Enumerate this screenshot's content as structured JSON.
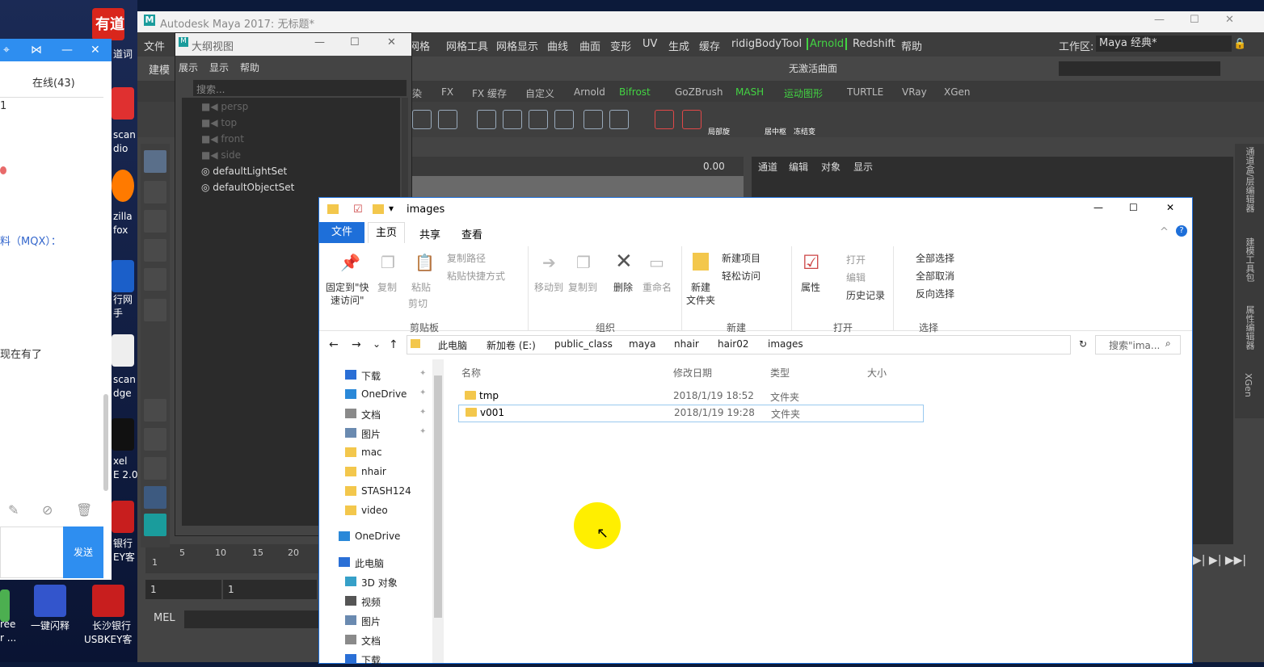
{
  "desktop": {
    "icons": [
      {
        "label": "有道",
        "color": "#d9261c"
      },
      {
        "label": "道词",
        "color": "#d9261c"
      },
      {
        "label": "scan",
        "color": "#e03030"
      },
      {
        "label": "dio",
        "color": "#e03030"
      },
      {
        "label": "zilla",
        "color": "#ff7a00"
      },
      {
        "label": "fox",
        "color": "#ff7a00"
      },
      {
        "label": "行网",
        "color": "#1b5fc9"
      },
      {
        "label": "手",
        "color": "#1b5fc9"
      },
      {
        "label": "scan",
        "color": "#eeeeee"
      },
      {
        "label": "dge",
        "color": "#eeeeee"
      },
      {
        "label": "xel",
        "color": "#111111"
      },
      {
        "label": "E 2.0",
        "color": "#111111"
      },
      {
        "label": "银行",
        "color": "#c81e1e"
      },
      {
        "label": "EY客",
        "color": "#c81e1e"
      },
      {
        "label": "一键闪释",
        "color": "#3355cc"
      },
      {
        "label": "长沙银行",
        "color": "#c81e1e"
      },
      {
        "label": "USBKEY客",
        "color": "#c81e1e"
      },
      {
        "label": "ree",
        "color": "#4caf50"
      },
      {
        "label": "r ...",
        "color": "#4caf50"
      }
    ]
  },
  "chat": {
    "status": "在线(43)",
    "lines": [
      "1",
      "料（MQX）：",
      "现在有了"
    ],
    "send_label": "发送"
  },
  "maya": {
    "title": "Autodesk Maya 2017: 无标题*",
    "menu": [
      "文件",
      "网格",
      "网格工具",
      "网格显示",
      "曲线",
      "曲面",
      "变形",
      "UV",
      "生成",
      "缓存",
      "ridigBodyTool",
      "Arnold",
      "Redshift",
      "帮助"
    ],
    "workspace_label": "工作区:",
    "workspace_value": "Maya 经典*",
    "left_mode": "建模",
    "no_live_surface": "无激活曲面",
    "shelf_tabs": [
      "染",
      "FX",
      "FX 缓存",
      "自定义",
      "Arnold",
      "Bifrost",
      "GoZBrush",
      "MASH",
      "运动图形",
      "TURTLE",
      "VRay",
      "XGen"
    ],
    "shelf_labels": [
      "局部旋",
      "居中枢",
      "冻结变"
    ],
    "viewport_value": "0.00",
    "channel_tabs": [
      "通道",
      "编辑",
      "对象",
      "显示"
    ],
    "side_tabs": [
      "通道盒/层编辑器",
      "建模工具包",
      "属性编辑器",
      "XGen"
    ],
    "timeline_ticks": [
      "1",
      "5",
      "10",
      "15",
      "20"
    ],
    "frame_fields": [
      "1",
      "1"
    ],
    "cmd_label": "MEL"
  },
  "outliner": {
    "title": "大纲视图",
    "menu": [
      "展示",
      "显示",
      "帮助"
    ],
    "search_placeholder": "搜索...",
    "items": [
      {
        "label": "persp",
        "dim": true
      },
      {
        "label": "top",
        "dim": true
      },
      {
        "label": "front",
        "dim": true
      },
      {
        "label": "side",
        "dim": true
      },
      {
        "label": "defaultLightSet",
        "dim": false
      },
      {
        "label": "defaultObjectSet",
        "dim": false
      }
    ]
  },
  "explorer": {
    "title": "images",
    "tabs": [
      "文件",
      "主页",
      "共享",
      "查看"
    ],
    "ribbon": {
      "pin": "固定到\"快",
      "pin2": "速访问\"",
      "copy": "复制",
      "paste": "粘贴",
      "copy_path": "复制路径",
      "paste_shortcut": "粘贴快捷方式",
      "cut": "剪切",
      "move_to": "移动到",
      "copy_to": "复制到",
      "delete": "删除",
      "rename": "重命名",
      "new_folder": "新建",
      "new_folder2": "文件夹",
      "new_item": "新建项目",
      "easy_access": "轻松访问",
      "properties": "属性",
      "open": "打开",
      "edit": "编辑",
      "history": "历史记录",
      "select_all": "全部选择",
      "select_none": "全部取消",
      "invert": "反向选择",
      "groups": [
        "剪贴板",
        "组织",
        "新建",
        "打开",
        "选择"
      ]
    },
    "breadcrumb": [
      "此电脑",
      "新加卷 (E:)",
      "public_class",
      "maya",
      "nhair",
      "hair02",
      "images"
    ],
    "search_placeholder": "搜索\"ima...",
    "nav": [
      {
        "label": "下载",
        "icon": "download-icon",
        "pin": true
      },
      {
        "label": "OneDrive",
        "icon": "cloud-icon",
        "pin": true
      },
      {
        "label": "文档",
        "icon": "document-icon",
        "pin": true
      },
      {
        "label": "图片",
        "icon": "picture-icon",
        "pin": true
      },
      {
        "label": "mac",
        "icon": "folder-icon",
        "pin": false
      },
      {
        "label": "nhair",
        "icon": "folder-icon",
        "pin": false
      },
      {
        "label": "STASH124",
        "icon": "folder-icon",
        "pin": false
      },
      {
        "label": "video",
        "icon": "folder-icon",
        "pin": false
      },
      {
        "label": "OneDrive",
        "icon": "cloud-icon",
        "pin": false
      },
      {
        "label": "此电脑",
        "icon": "computer-icon",
        "pin": false
      },
      {
        "label": "3D 对象",
        "icon": "cube-icon",
        "pin": false
      },
      {
        "label": "视频",
        "icon": "video-icon",
        "pin": false
      },
      {
        "label": "图片",
        "icon": "picture-icon",
        "pin": false
      },
      {
        "label": "文档",
        "icon": "document-icon",
        "pin": false
      },
      {
        "label": "下载",
        "icon": "download-icon",
        "pin": false
      }
    ],
    "columns": [
      "名称",
      "修改日期",
      "类型",
      "大小"
    ],
    "files": [
      {
        "name": "tmp",
        "date": "2018/1/19 18:52",
        "type": "文件夹",
        "selected": false
      },
      {
        "name": "v001",
        "date": "2018/1/19 19:28",
        "type": "文件夹",
        "selected": true
      }
    ]
  },
  "colors": {
    "accent": "#1e6fd9",
    "arnold": "#43d443",
    "folder": "#f3c74c"
  }
}
